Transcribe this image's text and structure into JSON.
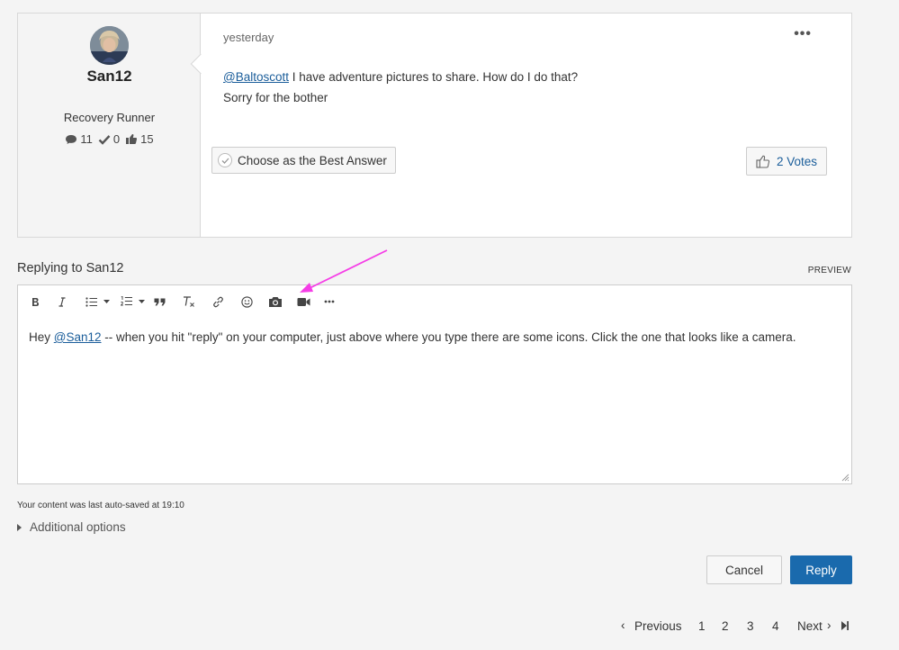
{
  "post": {
    "author": {
      "name": "San12",
      "rank": "Recovery Runner",
      "stats": {
        "messages": "11",
        "solutions": "0",
        "kudos": "15"
      }
    },
    "date": "yesterday",
    "more_label": "•••",
    "mention": "@Baltoscott",
    "line1": " I have adventure pictures to share. How do I do that?",
    "line2": "Sorry for the bother",
    "best_answer_label": "Choose as the Best Answer",
    "votes_label": "2 Votes"
  },
  "reply": {
    "heading": "Replying to San12",
    "preview_label": "PREVIEW",
    "toolbar_icons": [
      "bold-icon",
      "italic-icon",
      "bulleted-list-icon",
      "numbered-list-icon",
      "blockquote-icon",
      "clear-format-icon",
      "link-icon",
      "emoji-icon",
      "camera-icon",
      "video-icon",
      "more-icon"
    ],
    "body_prefix": "Hey ",
    "body_mention": "@San12",
    "body_suffix": " -- when you hit \"reply\" on your computer, just above where you type there are some icons.  Click the one that looks like a camera.",
    "annotation_arrow_color": "#f53de6"
  },
  "autosave_text": "Your content was last auto-saved at 19:10",
  "additional_options_label": "Additional options",
  "buttons": {
    "cancel": "Cancel",
    "reply": "Reply"
  },
  "pagination": {
    "previous": "Previous",
    "pages": [
      "1",
      "2",
      "3",
      "4"
    ],
    "current": "3",
    "next": "Next"
  },
  "colors": {
    "accent": "#1a6aad",
    "link": "#1a5d9a",
    "background": "#f4f4f4"
  }
}
